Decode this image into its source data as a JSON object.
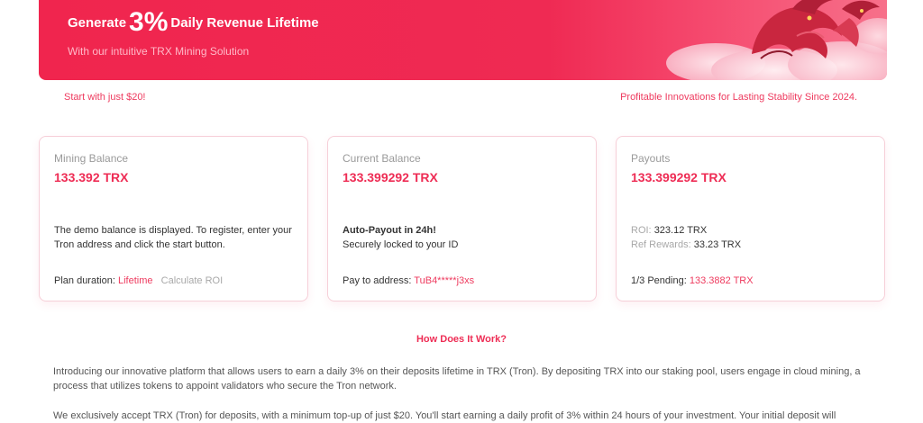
{
  "hero": {
    "title_pre": "Generate",
    "title_big": "3%",
    "title_post": "Daily Revenue Lifetime",
    "subtitle": "With our intuitive TRX Mining Solution",
    "art_icon": "dragon-illustration",
    "gradient_colors": [
      "#f0254e",
      "#f7708a"
    ]
  },
  "taglines": {
    "left": "Start with just $20!",
    "right": "Profitable Innovations for Lasting Stability Since 2024."
  },
  "cards": {
    "mining": {
      "title": "Mining Balance",
      "value": "133.392 TRX",
      "body": "The demo balance is displayed. To register, enter your Tron address and click the start button.",
      "plan_label": "Plan duration:",
      "plan_value": "Lifetime",
      "calc_label": "Calculate ROI"
    },
    "current": {
      "title": "Current Balance",
      "value": "133.399292 TRX",
      "body_strong": "Auto-Payout in 24h!",
      "body": "Securely locked to your ID",
      "pay_label": "Pay to address:",
      "pay_value": "TuB4*****j3xs"
    },
    "payouts": {
      "title": "Payouts",
      "value": "133.399292 TRX",
      "roi_label": "ROI:",
      "roi_value": "323.12 TRX",
      "ref_label": "Ref Rewards:",
      "ref_value": "33.23 TRX",
      "pending_label": "1/3 Pending:",
      "pending_value": "133.3882 TRX"
    }
  },
  "how": {
    "heading": "How Does It Work?",
    "p1": "Introducing our innovative platform that allows users to earn a daily 3% on their deposits lifetime in TRX (Tron). By depositing TRX into our staking pool, users engage in cloud mining, a process that utilizes tokens to appoint validators who secure the Tron network.",
    "p2": "We exclusively accept TRX (Tron) for deposits, with a minimum top-up of just $20. You'll start earning a daily profit of 3% within 24 hours of your investment. Your initial deposit will"
  },
  "colors": {
    "accent": "#ee2d55",
    "card_border": "#f6cfd8",
    "muted": "#9a9a9a"
  }
}
